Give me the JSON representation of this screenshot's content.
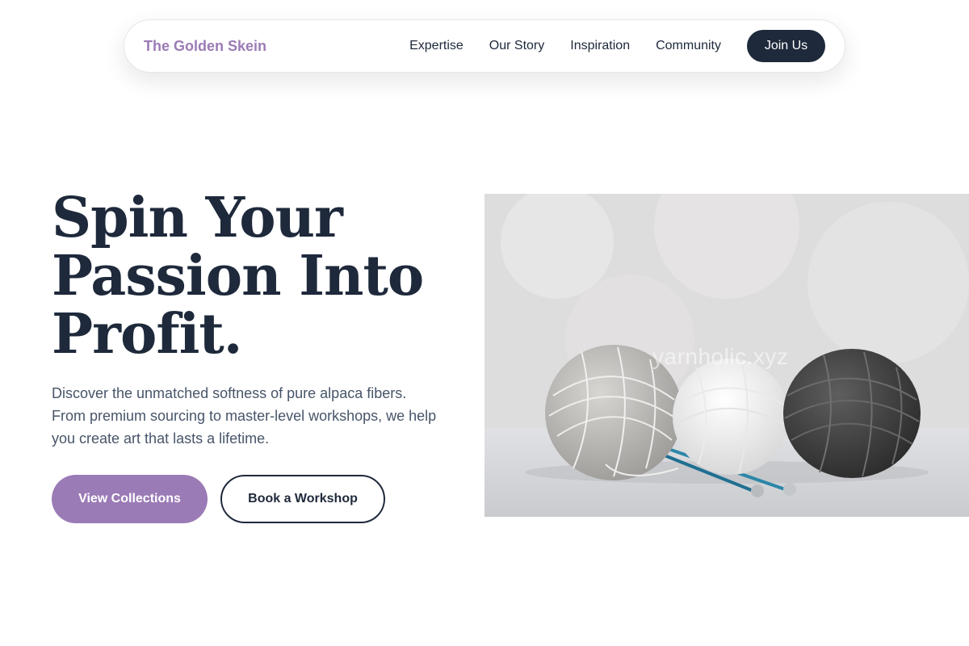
{
  "nav": {
    "brand": "The Golden Skein",
    "links": [
      "Expertise",
      "Our Story",
      "Inspiration",
      "Community"
    ],
    "cta": "Join Us"
  },
  "hero": {
    "title_lines": [
      "Spin Your",
      "Passion Into",
      "Profit."
    ],
    "description": "Discover the unmatched softness of pure alpaca fibers. From premium sourcing to master-level workshops, we help you create art that lasts a lifetime.",
    "primary_button": "View Collections",
    "secondary_button": "Book a Workshop",
    "image": {
      "alt": "Three balls of yarn (light grey, white, dark charcoal) with blue knitting needles",
      "watermark": "yarnholic.xyz"
    }
  },
  "colors": {
    "accent": "#9b7bb6",
    "navy": "#1e293b",
    "body_text": "#475569"
  }
}
